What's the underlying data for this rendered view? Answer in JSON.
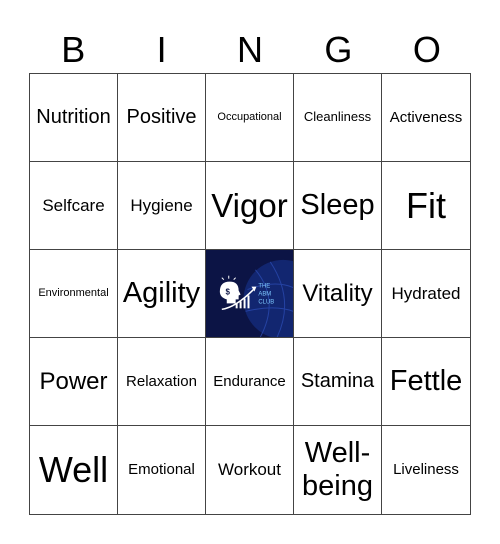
{
  "header": {
    "letters": [
      "B",
      "I",
      "N",
      "G",
      "O"
    ]
  },
  "cells": [
    "Nutrition",
    "Positive",
    "Occupational",
    "Cleanliness",
    "Activeness",
    "Selfcare",
    "Hygiene",
    "Vigor",
    "Sleep",
    "Fit",
    "Environmental",
    "Agility",
    "",
    "Vitality",
    "Hydrated",
    "Power",
    "Relaxation",
    "Endurance",
    "Stamina",
    "Fettle",
    "Well",
    "Emotional",
    "Workout",
    "Well-being",
    "Liveliness"
  ],
  "free_space": {
    "logo_text": [
      "THE",
      "ABM",
      "CLUB"
    ],
    "icon": "head-with-dollar-and-growth-chart-icon",
    "colors": {
      "background": "#0c1445",
      "accent": "#ffffff",
      "globe": "#1a3a9a"
    }
  }
}
